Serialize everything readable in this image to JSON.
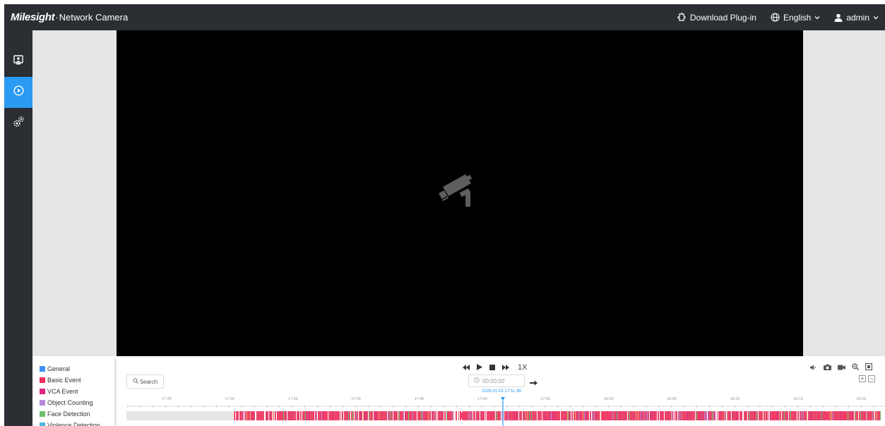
{
  "header": {
    "brand_logo": "Milesight",
    "brand_separator": "·",
    "brand_product": "Network Camera",
    "download_label": "Download Plug-in",
    "language_label": "English",
    "user_label": "admin"
  },
  "sidebar": {
    "items": [
      {
        "icon": "live-view-icon",
        "active": false
      },
      {
        "icon": "playback-icon",
        "active": true
      },
      {
        "icon": "settings-gears-icon",
        "active": false
      }
    ]
  },
  "legend": {
    "items": [
      {
        "label": "General",
        "color": "#3d8ff0"
      },
      {
        "label": "Basic Event",
        "color": "#f0305a"
      },
      {
        "label": "VCA Event",
        "color": "#e0257f"
      },
      {
        "label": "Object Counting",
        "color": "#b48ad8"
      },
      {
        "label": "Face Detection",
        "color": "#6cc06a"
      },
      {
        "label": "Violence Detection",
        "color": "#49b8d8"
      }
    ]
  },
  "playback": {
    "speed_label": "1X",
    "search_label": "Search",
    "time_value": "00:00:00",
    "cursor_datetime": "2026-01-03 17:51:46",
    "tick_labels": [
      "17:25",
      "17:30",
      "17:35",
      "17:40",
      "17:45",
      "17:50",
      "17:55",
      "18:00",
      "18:05",
      "18:10",
      "18:15",
      "18:20"
    ]
  },
  "colors": {
    "topbar": "#2b2e33",
    "accent": "#2b9af3",
    "video_bg": "#000000"
  }
}
